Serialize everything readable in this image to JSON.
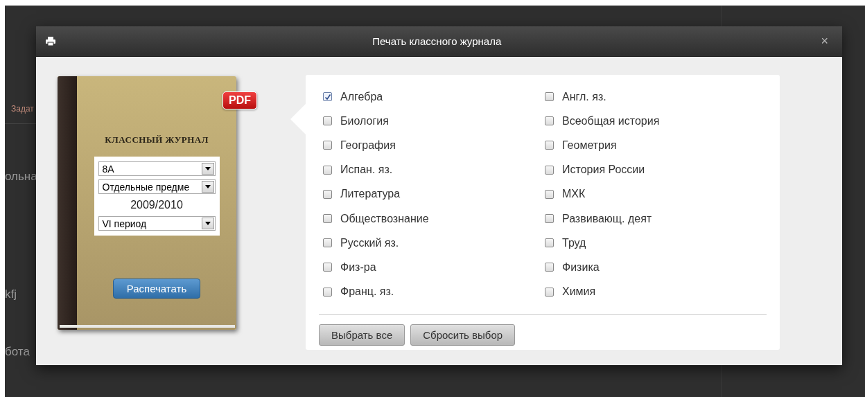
{
  "background": {
    "texts": [
      "Задат",
      "ольна",
      "kfj",
      "бота"
    ]
  },
  "dialog": {
    "title": "Печать классного журнала",
    "close": "×"
  },
  "journal": {
    "badge": "PDF",
    "heading": "КЛАССНЫЙ ЖУРНАЛ",
    "selects": [
      {
        "value": "8А"
      },
      {
        "value": "Отдельные предме"
      }
    ],
    "year": "2009/2010",
    "period": {
      "value": "VI период"
    },
    "print_button": "Распечатать"
  },
  "subjects": [
    {
      "label": "Алгебра",
      "checked": true
    },
    {
      "label": "Биология",
      "checked": false
    },
    {
      "label": "География",
      "checked": false
    },
    {
      "label": "Испан. яз.",
      "checked": false
    },
    {
      "label": "Литература",
      "checked": false
    },
    {
      "label": "Обществознание",
      "checked": false
    },
    {
      "label": "Русский яз.",
      "checked": false
    },
    {
      "label": "Физ-ра",
      "checked": false
    },
    {
      "label": "Франц. яз.",
      "checked": false
    },
    {
      "label": "Англ. яз.",
      "checked": false
    },
    {
      "label": "Всеобщая история",
      "checked": false
    },
    {
      "label": "Геометрия",
      "checked": false
    },
    {
      "label": "История России",
      "checked": false
    },
    {
      "label": "МХК",
      "checked": false
    },
    {
      "label": "Развивающ. деят",
      "checked": false
    },
    {
      "label": "Труд",
      "checked": false
    },
    {
      "label": "Физика",
      "checked": false
    },
    {
      "label": "Химия",
      "checked": false
    }
  ],
  "buttons": [
    "Выбрать все",
    "Сбросить выбор"
  ]
}
